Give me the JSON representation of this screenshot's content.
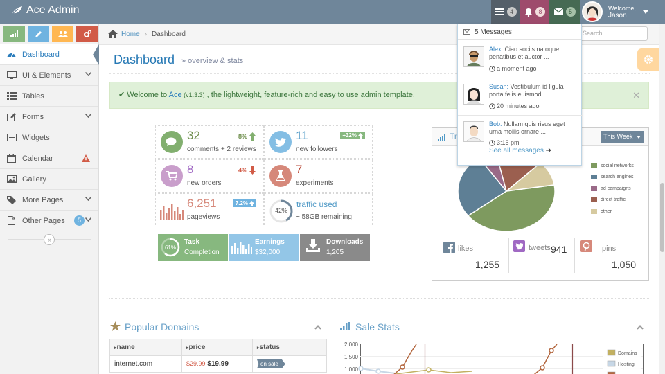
{
  "app": {
    "title": "Ace Admin"
  },
  "navbar": {
    "tasks_count": "4",
    "notifications_count": "8",
    "messages_count": "5",
    "welcome": "Welcome,",
    "user_name": "Jason"
  },
  "sidebar": {
    "items": [
      {
        "label": "Dashboard"
      },
      {
        "label": "UI & Elements"
      },
      {
        "label": "Tables"
      },
      {
        "label": "Forms"
      },
      {
        "label": "Widgets"
      },
      {
        "label": "Calendar"
      },
      {
        "label": "Gallery"
      },
      {
        "label": "More Pages"
      },
      {
        "label": "Other Pages",
        "badge": "5"
      }
    ]
  },
  "breadcrumb": {
    "home": "Home",
    "current": "Dashboard"
  },
  "search": {
    "placeholder": "Search ..."
  },
  "page": {
    "title": "Dashboard",
    "subtitle": "» overview & stats"
  },
  "alert": {
    "pre": "Welcome to ",
    "brand": "Ace",
    "version": " (v1.3.3)",
    "post": " , the lightweight, feature-rich and easy to use admin template."
  },
  "infoboxes": [
    {
      "number": "32",
      "label": "comments + 2 reviews",
      "stat": "8%"
    },
    {
      "number": "11",
      "label": "new followers",
      "badge": "+32%"
    },
    {
      "number": "8",
      "label": "new orders",
      "stat": "4%"
    },
    {
      "number": "7",
      "label": "experiments"
    },
    {
      "number": "6,251",
      "label": "pageviews",
      "badge": "7.2%"
    },
    {
      "number": "42%",
      "title": "traffic used",
      "label": "~ 58GB remaining"
    }
  ],
  "tiles": [
    {
      "percent": "61%",
      "line1": "Task",
      "line2": "Completion"
    },
    {
      "label": "Earnings",
      "value": "$32,000"
    },
    {
      "label": "Downloads",
      "value": "1,205"
    }
  ],
  "traffic": {
    "title": "Tr",
    "range": "This Week",
    "legend": [
      {
        "label": "social networks",
        "color": "#68bc31"
      },
      {
        "label": "search engines",
        "color": "#2091cf"
      },
      {
        "label": "ad campaigns",
        "color": "#af4e96"
      },
      {
        "label": "direct traffic",
        "color": "#da5430"
      },
      {
        "label": "other",
        "color": "#fee074"
      }
    ],
    "social": [
      {
        "name": "likes",
        "value": "1,255"
      },
      {
        "name": "tweets",
        "value": "941"
      },
      {
        "name": "pins",
        "value": "1,050"
      }
    ]
  },
  "messages": {
    "header": "5 Messages",
    "items": [
      {
        "from": "Alex:",
        "text": "Ciao sociis natoque penatibus et auctor ...",
        "time": "a moment ago"
      },
      {
        "from": "Susan:",
        "text": "Vestibulum id ligula porta felis euismod ...",
        "time": "20 minutes ago"
      },
      {
        "from": "Bob:",
        "text": "Nullam quis risus eget urna mollis ornare ...",
        "time": "3:15 pm"
      }
    ],
    "footer": "See all messages"
  },
  "domains": {
    "title": "Popular Domains",
    "headers": [
      "name",
      "price",
      "status"
    ],
    "rows": [
      {
        "name": "internet.com",
        "old_price": "$29.99",
        "price": "$19.99",
        "status": "on sale"
      }
    ]
  },
  "sale_stats": {
    "title": "Sale Stats",
    "legend": [
      "Domains",
      "Hosting"
    ]
  },
  "chart_data": {
    "type": "line",
    "title": "Sale Stats",
    "ylim": [
      0,
      2
    ],
    "y_ticks": [
      "2.000",
      "1.500",
      "1.000"
    ],
    "series": [
      {
        "name": "Domains",
        "color": "#a38d4e"
      },
      {
        "name": "Hosting",
        "color": "#c7d7e6"
      }
    ]
  }
}
